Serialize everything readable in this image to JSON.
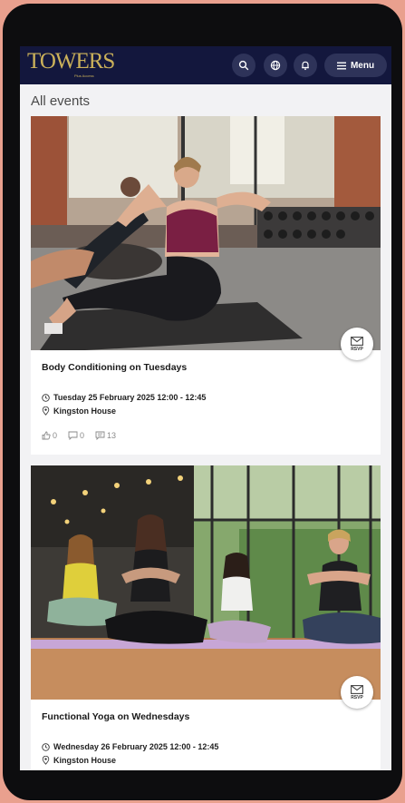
{
  "header": {
    "logo_text": "TOWERS",
    "logo_subtext": "Plus Access",
    "menu_label": "Menu",
    "icons": [
      "search-icon",
      "globe-icon",
      "bell-icon",
      "hamburger-icon"
    ]
  },
  "page": {
    "title": "All events"
  },
  "events": [
    {
      "title": "Body Conditioning on Tuesdays",
      "datetime": "Tuesday 25 February 2025 12:00 - 12:45",
      "location": "Kingston House",
      "rsvp_label": "RSVP",
      "likes": "0",
      "comments": "0",
      "views": "13"
    },
    {
      "title": "Functional Yoga on Wednesdays",
      "datetime": "Wednesday 26 February 2025 12:00 - 12:45",
      "location": "Kingston House",
      "rsvp_label": "RSVP"
    }
  ],
  "colors": {
    "header_bg": "#13173d",
    "logo_gold": "#cbb15a",
    "frame_bg": "#e9a08e"
  }
}
